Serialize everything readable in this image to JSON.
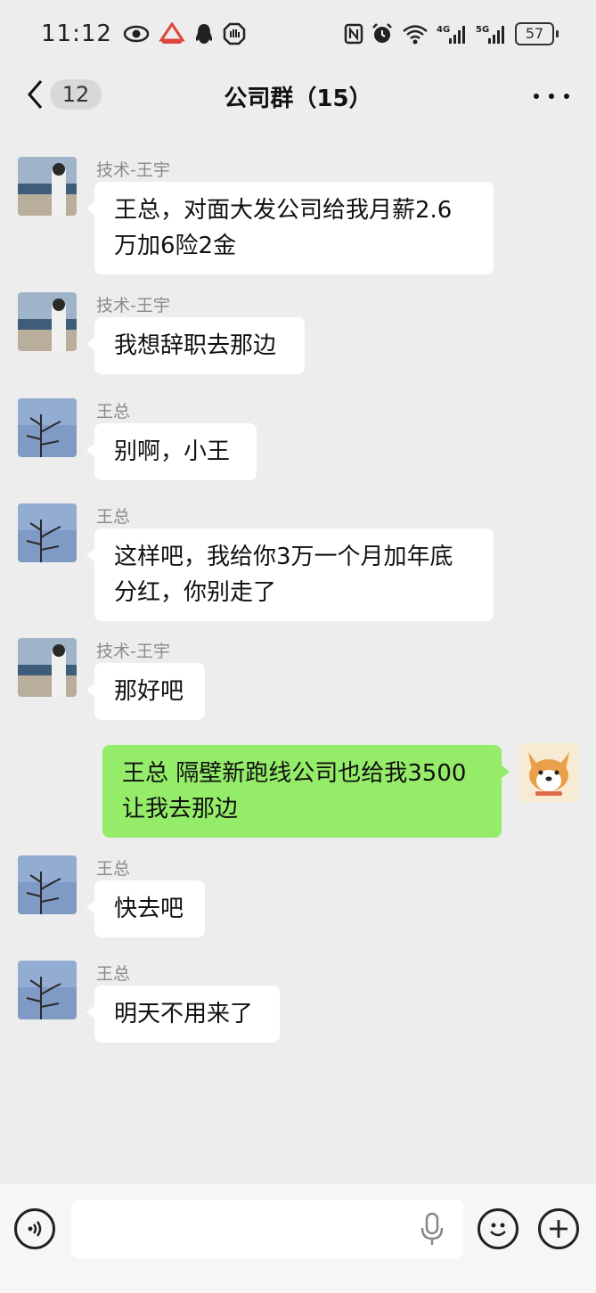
{
  "status_bar": {
    "time": "11:12",
    "battery": "57",
    "network_labels": [
      "4G",
      "5G"
    ]
  },
  "nav": {
    "back_badge": "12",
    "title": "公司群（15）"
  },
  "messages": [
    {
      "side": "left",
      "sender": "技术-王宇",
      "avatar": "sea-person-avatar",
      "lines": [
        "王总，对面大发公司给我月薪2.6",
        "万加6险2金"
      ]
    },
    {
      "side": "left",
      "sender": "技术-王宇",
      "avatar": "sea-person-avatar",
      "lines": [
        "我想辞职去那边"
      ]
    },
    {
      "side": "left",
      "sender": "王总",
      "avatar": "bare-tree-avatar",
      "lines": [
        "别啊，小王"
      ]
    },
    {
      "side": "left",
      "sender": "王总",
      "avatar": "bare-tree-avatar",
      "lines": [
        "这样吧，我给你3万一个月加年底",
        "分红，你别走了"
      ]
    },
    {
      "side": "left",
      "sender": "技术-王宇",
      "avatar": "sea-person-avatar",
      "lines": [
        "那好吧"
      ]
    },
    {
      "side": "right",
      "sender": "",
      "avatar": "shiba-dog-avatar",
      "lines": [
        "王总 隔壁新跑线公司也给我3500",
        "让我去那边"
      ]
    },
    {
      "side": "left",
      "sender": "王总",
      "avatar": "bare-tree-avatar",
      "lines": [
        "快去吧"
      ]
    },
    {
      "side": "left",
      "sender": "王总",
      "avatar": "bare-tree-avatar",
      "lines": [
        "明天不用来了"
      ]
    }
  ],
  "input_bar": {
    "placeholder": "",
    "icons": [
      "voice-icon",
      "mic-icon",
      "emoji-icon",
      "plus-icon"
    ]
  },
  "colors": {
    "background": "#ededed",
    "bubble_self": "#95ec69",
    "bubble_other": "#ffffff",
    "sender_name": "#8a8a8a"
  }
}
